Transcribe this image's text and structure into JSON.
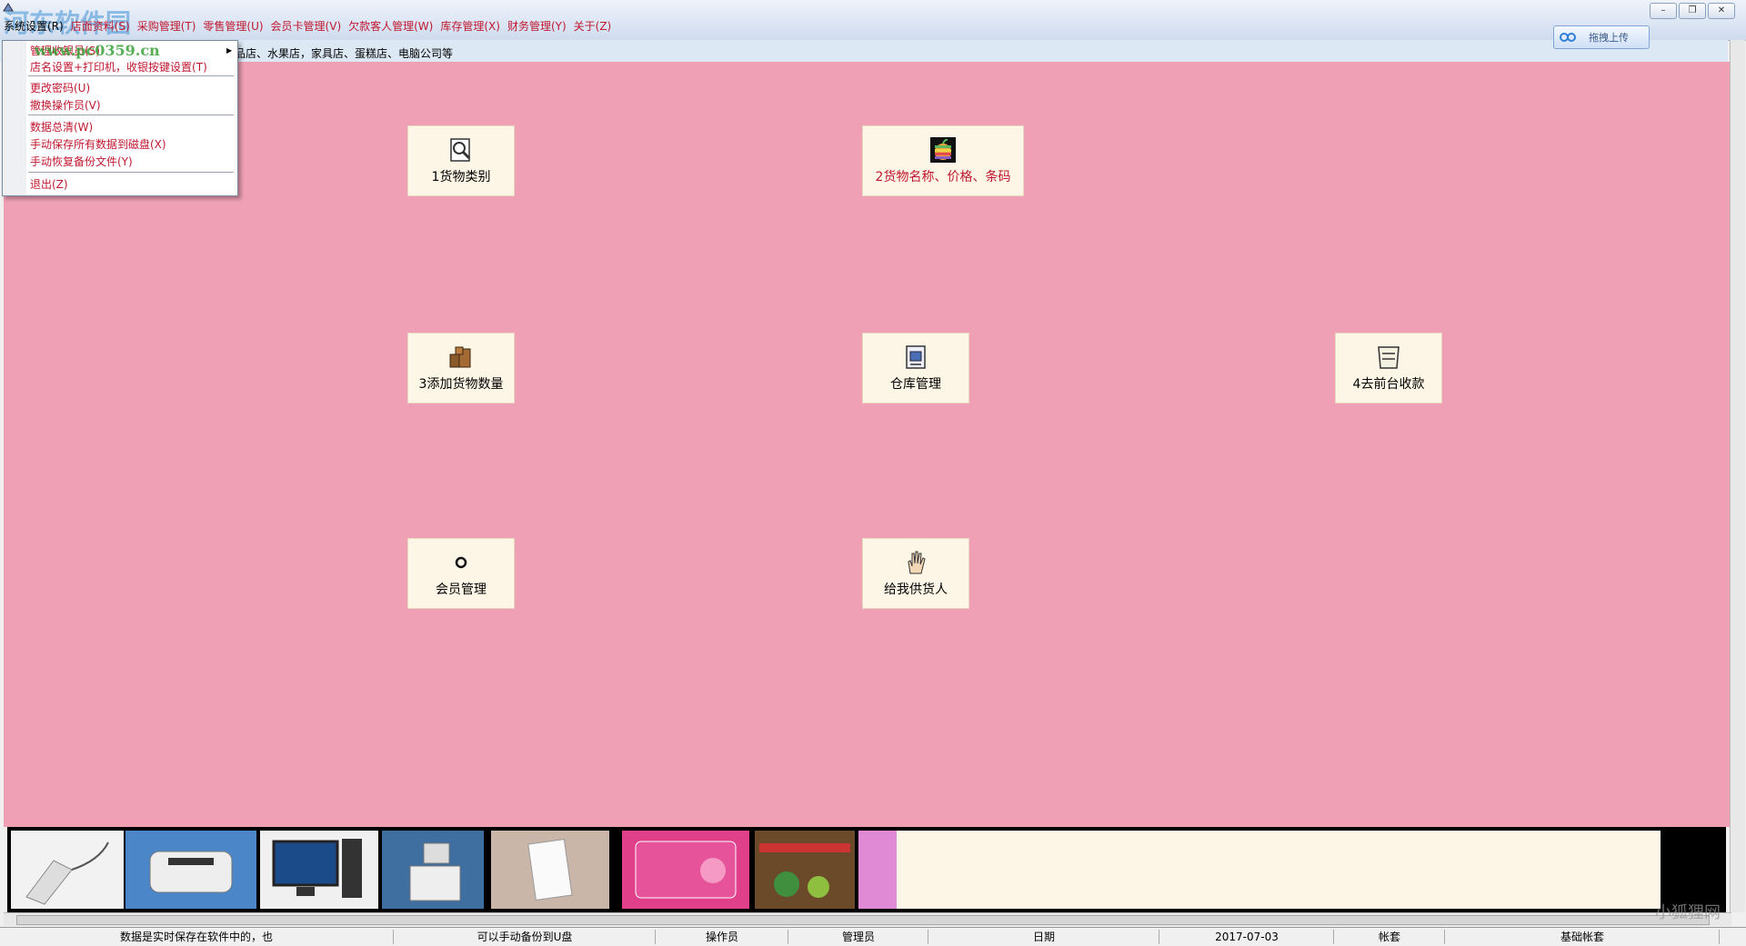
{
  "watermark": {
    "top_text": "河东软件园",
    "url": "www.pc0359.cn",
    "corner": "小狐狸网"
  },
  "menubar": {
    "items": [
      "系统设置(R)",
      "店面资料(S)",
      "采购管理(T)",
      "零售管理(U)",
      "会员卡管理(V)",
      "欠款客人管理(W)",
      "库存管理(X)",
      "财务管理(Y)",
      "关于(Z)"
    ]
  },
  "window_controls": {
    "minimize": "–",
    "restore": "❐",
    "close": "✕"
  },
  "upload": {
    "label": "拖拽上传"
  },
  "subtitle": "品店、水果店，家具店、蛋糕店、电脑公司等",
  "dropdown": {
    "items": [
      "管理收银员(S)",
      "店名设置+打印机，收银按键设置(T)",
      "更改密码(U)",
      "撤换操作员(V)",
      "数据总清(W)",
      "手动保存所有数据到磁盘(X)",
      "手动恢复备份文件(Y)",
      "退出(Z)"
    ]
  },
  "tiles": {
    "goods_category": "1货物类别",
    "goods_name": "2货物名称、价格、条码",
    "add_quantity": "3添加货物数量",
    "warehouse": "仓库管理",
    "cashier": "4去前台收款",
    "members": "会员管理",
    "supplier": "给我供货人"
  },
  "statusbar": {
    "note1": "数据是实时保存在软件中的，也",
    "note2": "可以手动备份到U盘",
    "operator_label": "操作员",
    "operator_value": "管理员",
    "date_label": "日期",
    "date_value": "2017-07-03",
    "account_label": "帐套",
    "account_value": "基础帐套"
  }
}
